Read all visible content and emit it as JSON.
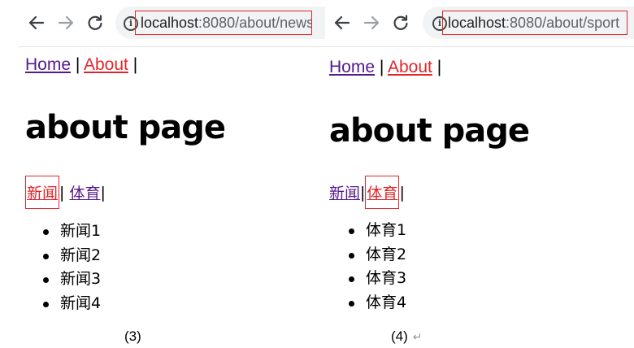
{
  "screens": [
    {
      "address": {
        "host": "localhost",
        "rest": ":8080/about/news"
      },
      "topnav": {
        "home": "Home",
        "sep1": " | ",
        "about": "About",
        "sep2": " |"
      },
      "title": "about page",
      "subnav": {
        "news": "新闻",
        "sep1": "|",
        "sports": "体育",
        "sep2": "|",
        "active": "news"
      },
      "items": [
        "新闻1",
        "新闻2",
        "新闻3",
        "新闻4"
      ],
      "caption": "(3)"
    },
    {
      "address": {
        "host": "localhost",
        "rest": ":8080/about/sport"
      },
      "topnav": {
        "home": "Home",
        "sep1": " | ",
        "about": "About",
        "sep2": " |"
      },
      "title": "about page",
      "subnav": {
        "news": "新闻",
        "sep1": "|",
        "sports": "体育",
        "sep2": "|",
        "active": "sports"
      },
      "items": [
        "体育1",
        "体育2",
        "体育3",
        "体育4"
      ],
      "caption": "(4)",
      "caption_mark": "↵"
    }
  ],
  "colors": {
    "active_link": "#e0262b",
    "visited_link": "#551a8b",
    "highlight_box": "#e0262b"
  },
  "icons": [
    "back-arrow-icon",
    "forward-arrow-icon",
    "reload-icon",
    "info-icon"
  ]
}
